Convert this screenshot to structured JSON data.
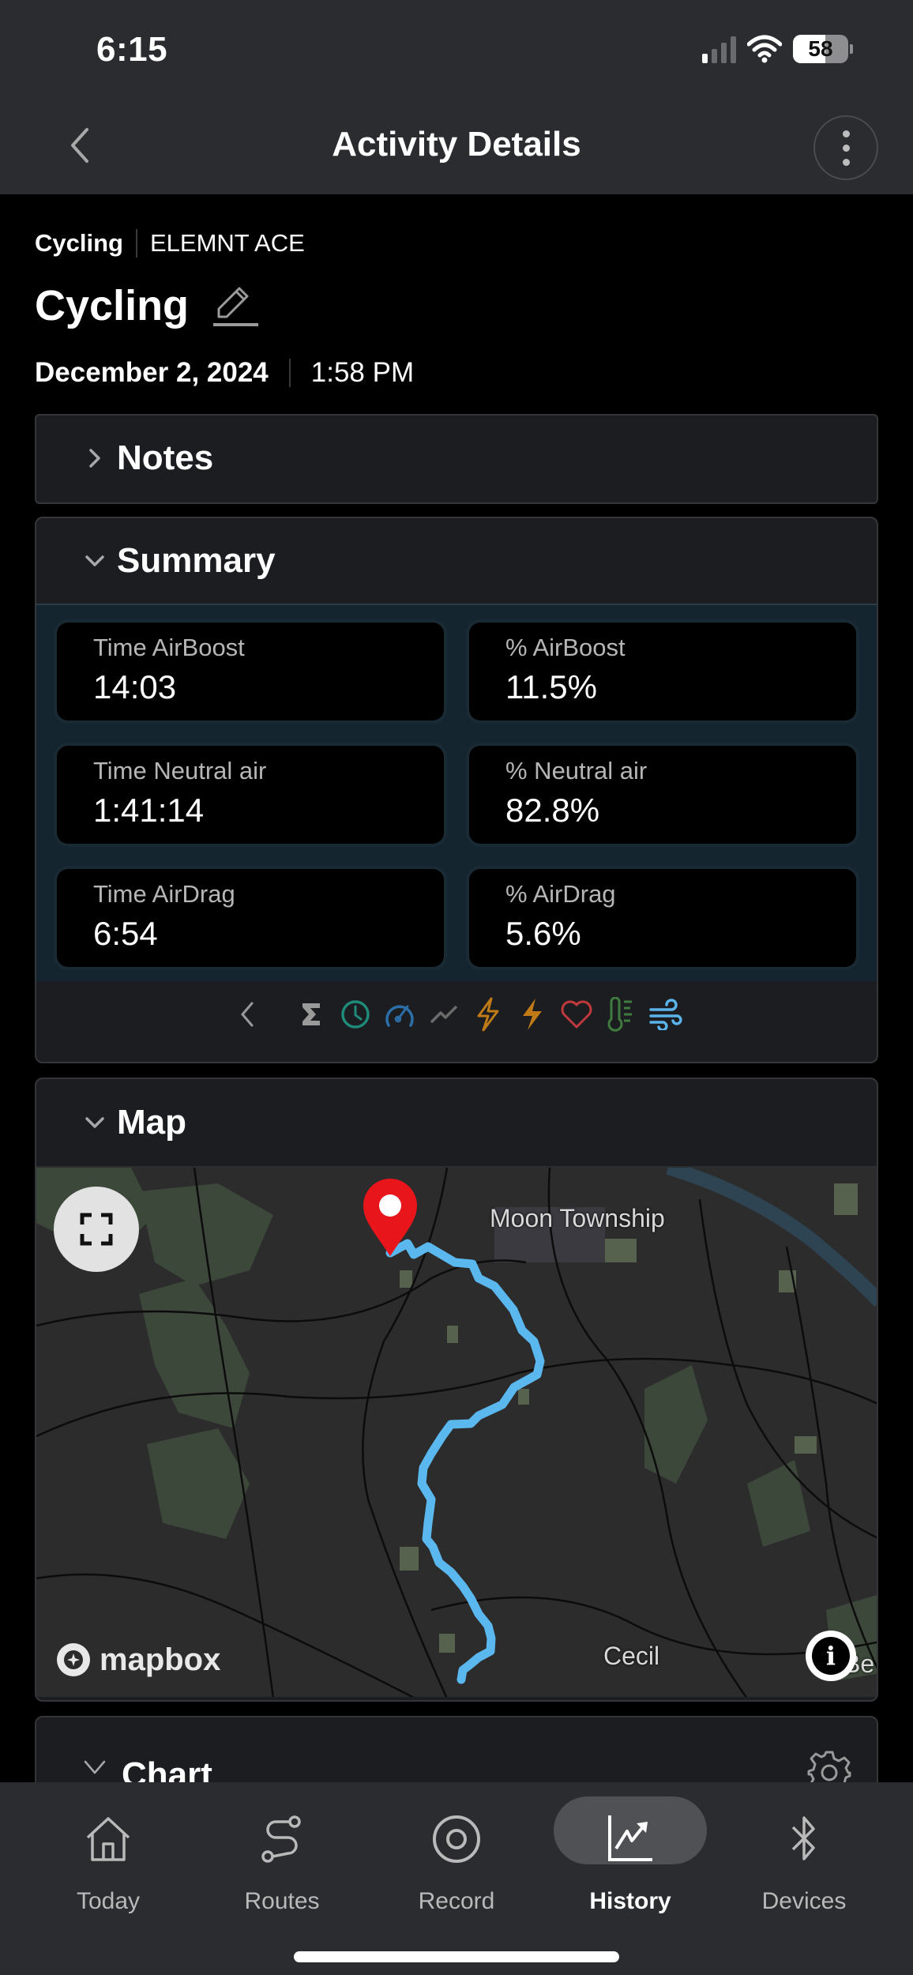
{
  "status_bar": {
    "time": "6:15",
    "battery": "58",
    "battery_level": 0.58,
    "signal_bars_active": 1,
    "wifi": true
  },
  "header": {
    "title": "Activity Details",
    "back_icon": "chevron-left-icon",
    "more_icon": "more-vertical-icon"
  },
  "activity": {
    "sport": "Cycling",
    "device": "ELEMNT ACE",
    "name": "Cycling",
    "edit_icon": "pencil-icon",
    "date": "December 2, 2024",
    "time": "1:58 PM"
  },
  "sections": {
    "notes": {
      "title": "Notes",
      "expanded": false
    },
    "summary": {
      "title": "Summary",
      "expanded": true,
      "tiles": [
        {
          "label": "Time AirBoost",
          "value": "14:03"
        },
        {
          "label": "% AirBoost",
          "value": "11.5%"
        },
        {
          "label": "Time Neutral air",
          "value": "1:41:14"
        },
        {
          "label": "% Neutral air",
          "value": "82.8%"
        },
        {
          "label": "Time AirDrag",
          "value": "6:54"
        },
        {
          "label": "% AirDrag",
          "value": "5.6%"
        }
      ],
      "category_icons": [
        {
          "name": "chevron-left-icon",
          "color": "#9a9a9a"
        },
        {
          "name": "sigma-icon",
          "color": "#9a9a9a"
        },
        {
          "name": "clock-icon",
          "color": "#1f8a7a"
        },
        {
          "name": "speedometer-icon",
          "color": "#2c6ea8"
        },
        {
          "name": "elevation-icon",
          "color": "#6b6b6b"
        },
        {
          "name": "power-outline-icon",
          "color": "#c07a18"
        },
        {
          "name": "power-filled-icon",
          "color": "#c07a18"
        },
        {
          "name": "heart-icon",
          "color": "#c0393b"
        },
        {
          "name": "thermometer-icon",
          "color": "#3f7a3f"
        },
        {
          "name": "wind-icon",
          "color": "#5ab4ea"
        }
      ]
    },
    "map": {
      "title": "Map",
      "expanded": true,
      "labels": {
        "town_north": "Moon Township",
        "town_south": "Cecil",
        "edge": "Be"
      },
      "attribution": "mapbox",
      "route_color": "#5bb8ee",
      "pin_color": "#e8151b"
    },
    "chart": {
      "title": "Chart",
      "expanded": true,
      "settings_icon": "gear-icon"
    }
  },
  "tabbar": {
    "items": [
      {
        "label": "Today",
        "icon": "home-icon",
        "active": false
      },
      {
        "label": "Routes",
        "icon": "route-icon",
        "active": false
      },
      {
        "label": "Record",
        "icon": "record-icon",
        "active": false
      },
      {
        "label": "History",
        "icon": "chart-trend-icon",
        "active": true
      },
      {
        "label": "Devices",
        "icon": "bluetooth-icon",
        "active": false
      }
    ]
  }
}
